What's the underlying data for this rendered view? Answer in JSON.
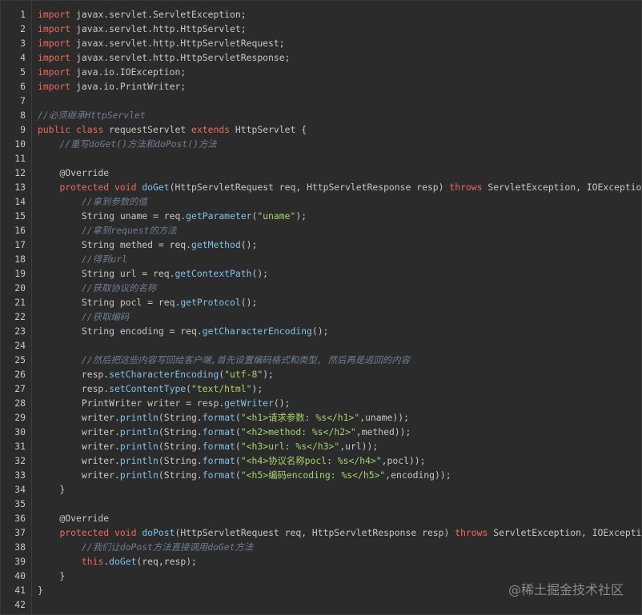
{
  "watermark": "@稀土掘金技术社区",
  "colors": {
    "background": "#2b2b2b",
    "keyword": "#f06a57",
    "method": "#7ec3e6",
    "string": "#a6d46c",
    "comment": "#6f7f8f",
    "plain": "#c5c8c6"
  },
  "lines": [
    {
      "n": "1",
      "tokens": [
        [
          "kw",
          "import"
        ],
        [
          "p",
          " javax.servlet.ServletException;"
        ]
      ]
    },
    {
      "n": "2",
      "tokens": [
        [
          "kw",
          "import"
        ],
        [
          "p",
          " javax.servlet.http.HttpServlet;"
        ]
      ]
    },
    {
      "n": "3",
      "tokens": [
        [
          "kw",
          "import"
        ],
        [
          "p",
          " javax.servlet.http.HttpServletRequest;"
        ]
      ]
    },
    {
      "n": "4",
      "tokens": [
        [
          "kw",
          "import"
        ],
        [
          "p",
          " javax.servlet.http.HttpServletResponse;"
        ]
      ]
    },
    {
      "n": "5",
      "tokens": [
        [
          "kw",
          "import"
        ],
        [
          "p",
          " java.io.IOException;"
        ]
      ]
    },
    {
      "n": "6",
      "tokens": [
        [
          "kw",
          "import"
        ],
        [
          "p",
          " java.io.PrintWriter;"
        ]
      ]
    },
    {
      "n": "7",
      "tokens": []
    },
    {
      "n": "8",
      "tokens": [
        [
          "cmt",
          "//必须继承HttpServlet"
        ]
      ]
    },
    {
      "n": "9",
      "tokens": [
        [
          "kw",
          "public"
        ],
        [
          "p",
          " "
        ],
        [
          "kw",
          "class"
        ],
        [
          "p",
          " requestServlet "
        ],
        [
          "kw",
          "extends"
        ],
        [
          "p",
          " HttpServlet {"
        ]
      ]
    },
    {
      "n": "10",
      "tokens": [
        [
          "p",
          "    "
        ],
        [
          "cmt",
          "//重写doGet()方法和doPost()方法"
        ]
      ]
    },
    {
      "n": "11",
      "tokens": []
    },
    {
      "n": "12",
      "tokens": [
        [
          "p",
          "    @Override"
        ]
      ]
    },
    {
      "n": "13",
      "tokens": [
        [
          "p",
          "    "
        ],
        [
          "kw",
          "protected"
        ],
        [
          "p",
          " "
        ],
        [
          "kw",
          "void"
        ],
        [
          "p",
          " "
        ],
        [
          "fn",
          "doGet"
        ],
        [
          "p",
          "(HttpServletRequest req, HttpServletResponse resp) "
        ],
        [
          "kw",
          "throws"
        ],
        [
          "p",
          " ServletException, IOException {"
        ]
      ]
    },
    {
      "n": "14",
      "tokens": [
        [
          "p",
          "        "
        ],
        [
          "cmt",
          "//拿到参数的值"
        ]
      ]
    },
    {
      "n": "15",
      "tokens": [
        [
          "p",
          "        String uname = req."
        ],
        [
          "fn",
          "getParameter"
        ],
        [
          "p",
          "("
        ],
        [
          "str",
          "\"uname\""
        ],
        [
          "p",
          ");"
        ]
      ]
    },
    {
      "n": "16",
      "tokens": [
        [
          "p",
          "        "
        ],
        [
          "cmt",
          "//拿到request的方法"
        ]
      ]
    },
    {
      "n": "17",
      "tokens": [
        [
          "p",
          "        String methed = req."
        ],
        [
          "fn",
          "getMethod"
        ],
        [
          "p",
          "();"
        ]
      ]
    },
    {
      "n": "18",
      "tokens": [
        [
          "p",
          "        "
        ],
        [
          "cmt",
          "//得到url"
        ]
      ]
    },
    {
      "n": "19",
      "tokens": [
        [
          "p",
          "        String url = req."
        ],
        [
          "fn",
          "getContextPath"
        ],
        [
          "p",
          "();"
        ]
      ]
    },
    {
      "n": "20",
      "tokens": [
        [
          "p",
          "        "
        ],
        [
          "cmt",
          "//获取协议的名称"
        ]
      ]
    },
    {
      "n": "21",
      "tokens": [
        [
          "p",
          "        String pocl = req."
        ],
        [
          "fn",
          "getProtocol"
        ],
        [
          "p",
          "();"
        ]
      ]
    },
    {
      "n": "22",
      "tokens": [
        [
          "p",
          "        "
        ],
        [
          "cmt",
          "//获取编码"
        ]
      ]
    },
    {
      "n": "23",
      "tokens": [
        [
          "p",
          "        String encoding = req."
        ],
        [
          "fn",
          "getCharacterEncoding"
        ],
        [
          "p",
          "();"
        ]
      ]
    },
    {
      "n": "24",
      "tokens": []
    },
    {
      "n": "25",
      "tokens": [
        [
          "p",
          "        "
        ],
        [
          "cmt",
          "//然后把这些内容写回给客户端,首先设置编码格式和类型, 然后再是返回的内容"
        ]
      ]
    },
    {
      "n": "26",
      "tokens": [
        [
          "p",
          "        resp."
        ],
        [
          "fn",
          "setCharacterEncoding"
        ],
        [
          "p",
          "("
        ],
        [
          "str",
          "\"utf-8\""
        ],
        [
          "p",
          ");"
        ]
      ]
    },
    {
      "n": "27",
      "tokens": [
        [
          "p",
          "        resp."
        ],
        [
          "fn",
          "setContentType"
        ],
        [
          "p",
          "("
        ],
        [
          "str",
          "\"text/html\""
        ],
        [
          "p",
          ");"
        ]
      ]
    },
    {
      "n": "28",
      "tokens": [
        [
          "p",
          "        PrintWriter writer = resp."
        ],
        [
          "fn",
          "getWriter"
        ],
        [
          "p",
          "();"
        ]
      ]
    },
    {
      "n": "29",
      "tokens": [
        [
          "p",
          "        writer."
        ],
        [
          "fn",
          "println"
        ],
        [
          "p",
          "(String."
        ],
        [
          "fn",
          "format"
        ],
        [
          "p",
          "("
        ],
        [
          "str",
          "\"<h1>请求参数: %s</h1>\""
        ],
        [
          "p",
          ",uname));"
        ]
      ]
    },
    {
      "n": "30",
      "tokens": [
        [
          "p",
          "        writer."
        ],
        [
          "fn",
          "println"
        ],
        [
          "p",
          "(String."
        ],
        [
          "fn",
          "format"
        ],
        [
          "p",
          "("
        ],
        [
          "str",
          "\"<h2>method: %s</h2>\""
        ],
        [
          "p",
          ",methed));"
        ]
      ]
    },
    {
      "n": "31",
      "tokens": [
        [
          "p",
          "        writer."
        ],
        [
          "fn",
          "println"
        ],
        [
          "p",
          "(String."
        ],
        [
          "fn",
          "format"
        ],
        [
          "p",
          "("
        ],
        [
          "str",
          "\"<h3>url: %s</h3>\""
        ],
        [
          "p",
          ",url));"
        ]
      ]
    },
    {
      "n": "32",
      "tokens": [
        [
          "p",
          "        writer."
        ],
        [
          "fn",
          "println"
        ],
        [
          "p",
          "(String."
        ],
        [
          "fn",
          "format"
        ],
        [
          "p",
          "("
        ],
        [
          "str",
          "\"<h4>协议名称pocl: %s</h4>\""
        ],
        [
          "p",
          ",pocl));"
        ]
      ]
    },
    {
      "n": "33",
      "tokens": [
        [
          "p",
          "        writer."
        ],
        [
          "fn",
          "println"
        ],
        [
          "p",
          "(String."
        ],
        [
          "fn",
          "format"
        ],
        [
          "p",
          "("
        ],
        [
          "str",
          "\"<h5>编码encoding: %s</h5>\""
        ],
        [
          "p",
          ",encoding));"
        ]
      ]
    },
    {
      "n": "34",
      "tokens": [
        [
          "p",
          "    }"
        ]
      ]
    },
    {
      "n": "35",
      "tokens": []
    },
    {
      "n": "36",
      "tokens": [
        [
          "p",
          "    @Override"
        ]
      ]
    },
    {
      "n": "37",
      "tokens": [
        [
          "p",
          "    "
        ],
        [
          "kw",
          "protected"
        ],
        [
          "p",
          " "
        ],
        [
          "kw",
          "void"
        ],
        [
          "p",
          " "
        ],
        [
          "fn",
          "doPost"
        ],
        [
          "p",
          "(HttpServletRequest req, HttpServletResponse resp) "
        ],
        [
          "kw",
          "throws"
        ],
        [
          "p",
          " ServletException, IOException {"
        ]
      ]
    },
    {
      "n": "38",
      "tokens": [
        [
          "p",
          "        "
        ],
        [
          "cmt",
          "//我们让doPost方法直接调用doGet方法"
        ]
      ]
    },
    {
      "n": "39",
      "tokens": [
        [
          "p",
          "        "
        ],
        [
          "kw",
          "this"
        ],
        [
          "p",
          "."
        ],
        [
          "fn",
          "doGet"
        ],
        [
          "p",
          "(req,resp);"
        ]
      ]
    },
    {
      "n": "40",
      "tokens": [
        [
          "p",
          "    }"
        ]
      ]
    },
    {
      "n": "41",
      "tokens": [
        [
          "p",
          "}"
        ]
      ]
    },
    {
      "n": "42",
      "tokens": []
    }
  ]
}
